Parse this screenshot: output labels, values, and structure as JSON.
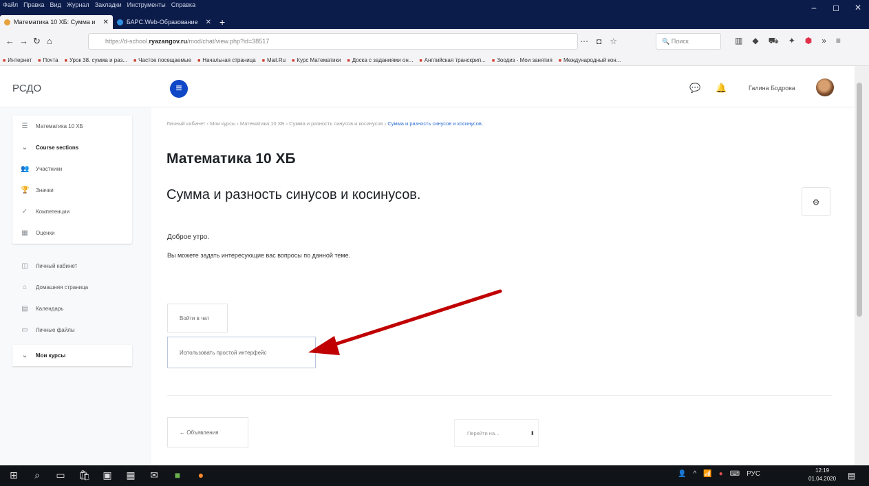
{
  "window": {
    "menu": [
      "Файл",
      "Правка",
      "Вид",
      "Журнал",
      "Закладки",
      "Инструменты",
      "Справка"
    ],
    "controls": [
      "–",
      "◻",
      "✕"
    ]
  },
  "tabs": [
    {
      "title": "Математика 10 ХБ: Сумма и",
      "active": true
    },
    {
      "title": "БАРС.Web-Образование",
      "active": false
    }
  ],
  "nav": {
    "url_prefix": "https://d-school.",
    "url_domain": "ryazangov.ru",
    "url_path": "/mod/chat/view.php?id=38517",
    "search_placeholder": "Поиск"
  },
  "bookmarks": [
    "Интернет",
    "Почта",
    "Урок 38. сумма и раз...",
    "Частое посещаемые",
    "Начальная страница",
    "Mail.Ru",
    "Курс Математики",
    "Доска с заданиями он...",
    "Английская транскрип...",
    "Зоодиз - Мои занятия",
    "Международный кон..."
  ],
  "site": {
    "brand": "РСДО",
    "user_name": "Галина Бодрова"
  },
  "sidebar": {
    "course_items": [
      {
        "label": "Математика 10 ХБ",
        "icon": "☰"
      },
      {
        "label": "Course sections",
        "icon": "⌄",
        "bold": true
      },
      {
        "label": "Участники",
        "icon": "👥"
      },
      {
        "label": "Значки",
        "icon": "🏆"
      },
      {
        "label": "Компетенции",
        "icon": "✓"
      },
      {
        "label": "Оценки",
        "icon": "▦"
      }
    ],
    "site_items": [
      {
        "label": "Личный кабинет",
        "icon": "◫"
      },
      {
        "label": "Домашняя страница",
        "icon": "⌂"
      },
      {
        "label": "Календарь",
        "icon": "▤"
      },
      {
        "label": "Личные файлы",
        "icon": "▭"
      },
      {
        "label": "Мои курсы",
        "icon": "⌄",
        "bold": true
      }
    ]
  },
  "breadcrumb": {
    "path": "Личный кабинет  ›  Мои курсы  ›  Математика 10 ХБ  ›  Сумма и разность синусов и косинусов  ›",
    "current": "Сумма и разность синусов и косинусов."
  },
  "main": {
    "course_title": "Математика 10 ХБ",
    "activity_title": "Сумма и разность синусов и косинусов.",
    "intro_line1": "Доброе утро.",
    "intro_line2": "Вы можете задать интересующие вас вопросы по данной теме.",
    "enter_chat": "Войти в чат",
    "simple_interface": "Использовать простой интерфейс",
    "prev_link": "← Объявления",
    "jump_to": "Перейти на...",
    "jump_caret": "⬍"
  },
  "annotation_arrow_color": "#c00000",
  "taskbar": {
    "lang": "РУС",
    "time": "12:19",
    "date": "01.04.2020"
  }
}
